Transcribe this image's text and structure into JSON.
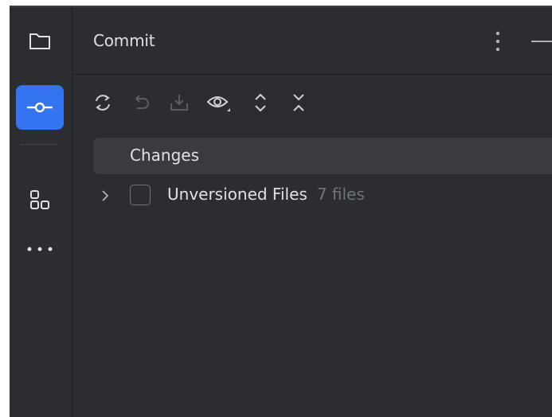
{
  "panel": {
    "title": "Commit"
  },
  "strip": {
    "items": [
      {
        "icon": "folder-icon",
        "active": false
      },
      {
        "icon": "commit-icon",
        "active": true
      },
      {
        "icon": "structure-icon",
        "active": false
      },
      {
        "icon": "more-icon",
        "active": false
      }
    ]
  },
  "toolbar": {
    "icons": [
      "refresh-icon",
      "rollback-icon",
      "shelve-icon",
      "preview-icon",
      "expand-all-icon",
      "collapse-all-icon"
    ]
  },
  "tree": {
    "group_label": "Changes",
    "rows": [
      {
        "label": "Unversioned Files",
        "count": "7 files"
      }
    ]
  },
  "colors": {
    "background": "#2b2d30",
    "accent": "#3574f0",
    "text": "#dfe1e5",
    "muted": "#6f737a",
    "selection": "#393b40"
  }
}
